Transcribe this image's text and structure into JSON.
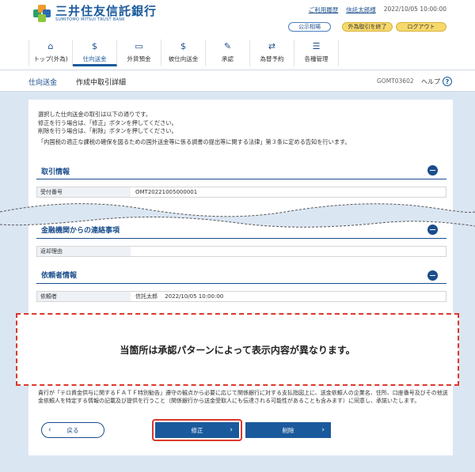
{
  "header": {
    "logo_jp": "三井住友信託銀行",
    "logo_en": "SUMITOMO MITSUI TRUST BANK",
    "links": {
      "usage_history": "ご利用履歴",
      "user_name": "信託太郎様",
      "datetime": "2022/10/05 10:00:00"
    },
    "buttons": {
      "public_notice": "公示相場",
      "foreign_end": "外為取引を終了",
      "logout": "ログアウト"
    }
  },
  "nav": [
    {
      "label": "トップ(外為)",
      "icon": "home-icon"
    },
    {
      "label": "仕向送金",
      "icon": "remittance-icon"
    },
    {
      "label": "外貨預金",
      "icon": "deposit-icon"
    },
    {
      "label": "被仕向送金",
      "icon": "incoming-remittance-icon"
    },
    {
      "label": "承認",
      "icon": "approval-icon"
    },
    {
      "label": "為替予約",
      "icon": "exchange-contract-icon"
    },
    {
      "label": "各種管理",
      "icon": "management-icon"
    }
  ],
  "subbar": {
    "section": "仕向送金",
    "page_title": "作成中取引詳細",
    "screen_id": "GOMT03602",
    "help": "ヘルプ",
    "help_icon": "?"
  },
  "intro": {
    "line1": "選択した仕向送金の取引は以下の通りです。",
    "line2": "修正を行う場合は、「修正」ボタンを押してください。",
    "line3": "削除を行う場合は、「削除」ボタンを押してください。",
    "line4": "「内国税の適正な課税の確保を図るための国外送金等に係る調書の提出等に関する法律」第３条に定める告知を行います。"
  },
  "sections": {
    "transaction": {
      "title": "取引情報",
      "rows": [
        {
          "label": "受付番号",
          "value": "OMT20221005000001"
        }
      ]
    },
    "bank_message": {
      "title": "金融機関からの連絡事項",
      "rows": [
        {
          "label": "返却理由",
          "value": ""
        }
      ]
    },
    "requester": {
      "title": "依頼者情報",
      "rows": [
        {
          "label": "依頼者",
          "value": "信託太郎　 2022/10/05 10:00:00"
        }
      ]
    }
  },
  "notice": "当箇所は承認パターンによって表示内容が異なります。",
  "footer_text": "貴行が「テロ資金供与に関するＦＡＴＦ特別勧告」遵守の観点から必要に応じて関係銀行に対する支払指図上に、送金依頼人の企業名、住所、口座番号及びその他送金依頼人を特定する情報の記載及び提供を行うこと（関係銀行から送金受取人にも伝達される可能性があることも含みます）に同意し、承諾いたします。",
  "buttons": {
    "back": "戻る",
    "edit": "修正",
    "delete": "削除",
    "back_icon": "‹",
    "forward_icon": "›"
  },
  "colors": {
    "brand": "#1a5a9c",
    "accent_yellow": "#f6d86b",
    "highlight_red": "#d9392d"
  }
}
